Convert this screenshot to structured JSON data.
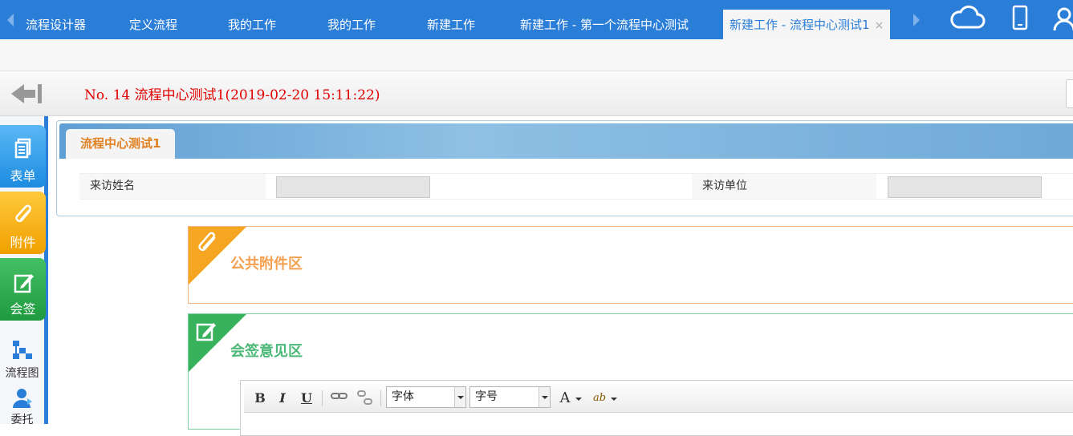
{
  "top_tabs": [
    {
      "label": "流程设计器"
    },
    {
      "label": "定义流程"
    },
    {
      "label": "我的工作"
    },
    {
      "label": "我的工作"
    },
    {
      "label": "新建工作"
    },
    {
      "label": "新建工作 - 第一个流程中心测试"
    },
    {
      "label": "新建工作 - 流程中心测试1",
      "active": true
    }
  ],
  "tab_close_glyph": "×",
  "top_icons": [
    "cloud-icon",
    "mobile-icon",
    "user-icon"
  ],
  "document": {
    "title": "No. 14 流程中心测试1(2019-02-20 15:11:22)"
  },
  "sidebar": {
    "items": [
      {
        "label": "表单",
        "icon": "form-icon",
        "color": "#1d8be0"
      },
      {
        "label": "附件",
        "icon": "paperclip-icon",
        "color": "#f0a000"
      },
      {
        "label": "会签",
        "icon": "edit-icon",
        "color": "#1f9a3e"
      },
      {
        "label": "流程图",
        "icon": "flowchart-icon"
      },
      {
        "label": "委托",
        "icon": "delegate-icon"
      }
    ]
  },
  "form": {
    "tab_label": "流程中心测试1",
    "fields": [
      {
        "label": "来访姓名",
        "value": ""
      },
      {
        "label": "来访单位",
        "value": ""
      }
    ]
  },
  "sections": {
    "attachments_title": "公共附件区",
    "countersign_title": "会签意见区"
  },
  "editor": {
    "bold": "B",
    "italic": "I",
    "underline": "U",
    "font_family_label": "字体",
    "font_size_label": "字号",
    "font_color_glyph": "A",
    "highlight_glyph": "ab"
  },
  "colors": {
    "accent_blue": "#2b7ed8",
    "title_red": "#e00000",
    "attach_orange": "#f5a623",
    "sign_green": "#37b15b"
  }
}
